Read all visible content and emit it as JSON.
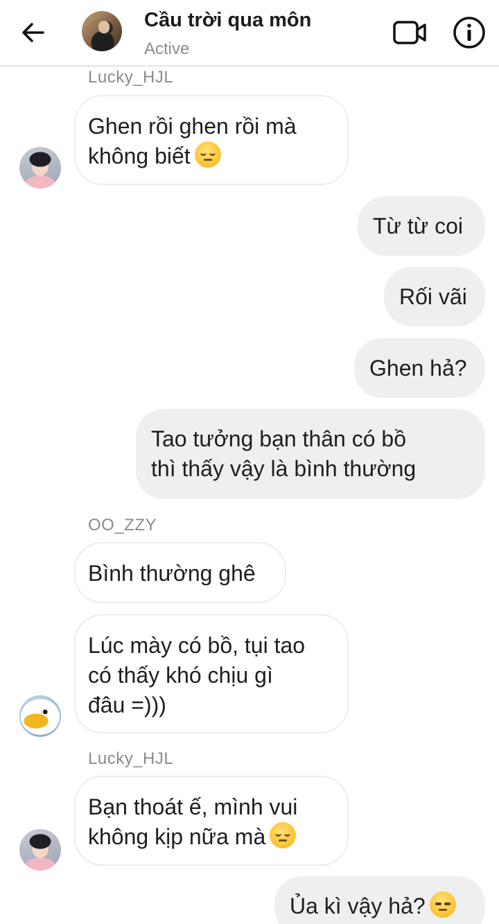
{
  "header": {
    "title": "Cầu trời qua môn",
    "status": "Active",
    "icons": {
      "back": "arrow-left-icon",
      "video": "video-camera-icon",
      "info": "info-icon"
    }
  },
  "messages": {
    "m1_sender": "Lucky_HJL",
    "m1_line1": "Ghen rồi ghen rồi mà",
    "m1_line2": "không biết",
    "m2": "Từ từ coi",
    "m3": "Rối vãi",
    "m4": "Ghen hả?",
    "m5_line1": "Tao tưởng bạn thân có bồ",
    "m5_line2": "thì thấy vậy là bình thường",
    "m6_sender": "OO_ZZY",
    "m6": "Bình thường ghê",
    "m7_line1": "Lúc mày có bồ, tụi tao",
    "m7_line2": "có thấy khó chịu gì",
    "m7_line3": "đâu =)))",
    "m8_sender": "Lucky_HJL",
    "m8_line1": "Bạn thoát ế, mình vui",
    "m8_line2": "không kịp nữa mà",
    "m9": "Ủa kì vậy hả?"
  },
  "colors": {
    "outgoing_bubble": "#efefef",
    "incoming_bubble": "#ffffff",
    "incoming_border": "#ececec",
    "secondary_text": "#8a8a8a"
  }
}
